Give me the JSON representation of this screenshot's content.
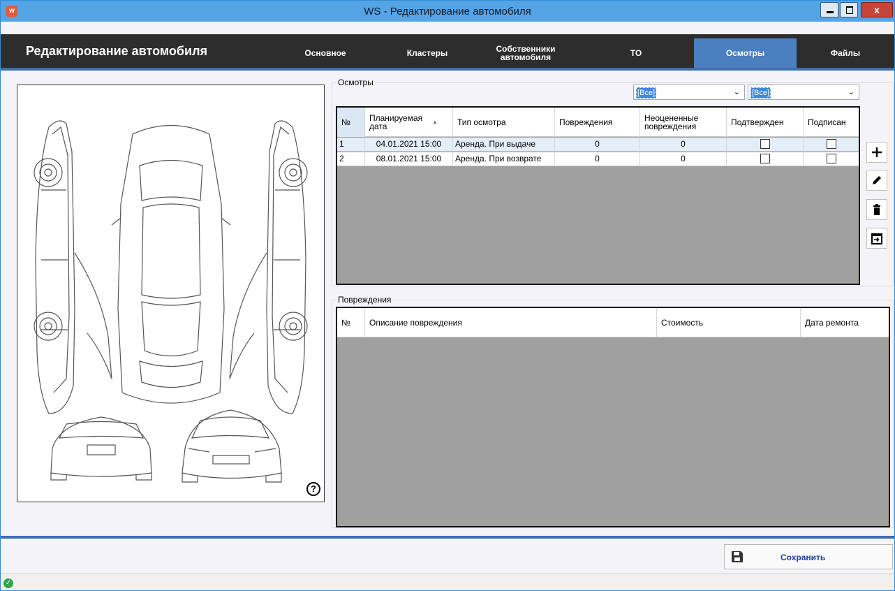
{
  "window": {
    "title": "WS - Редактирование автомобиля",
    "icon_letter": "w",
    "close_glyph": "x"
  },
  "header": {
    "title": "Редактирование автомобиля",
    "tabs": [
      {
        "label": "Основное"
      },
      {
        "label": "Кластеры"
      },
      {
        "label": "Собственники автомобиля"
      },
      {
        "label": "ТО"
      },
      {
        "label": "Осмотры",
        "active": true
      },
      {
        "label": "Файлы"
      }
    ]
  },
  "inspections": {
    "group_label": "Осмотры",
    "filter1": "[Все]",
    "filter2": "[Все]",
    "columns": [
      "№",
      "Планируемая дата",
      "Тип осмотра",
      "Повреждения",
      "Неоцененные повреждения",
      "Подтвержден",
      "Подписан"
    ],
    "rows": [
      {
        "no": "1",
        "date": "04.01.2021 15:00",
        "type": "Аренда. При выдаче",
        "damages": "0",
        "unassessed": "0",
        "confirmed": false,
        "signed": false
      },
      {
        "no": "2",
        "date": "08.01.2021 15:00",
        "type": "Аренда. При возврате",
        "damages": "0",
        "unassessed": "0",
        "confirmed": false,
        "signed": false
      }
    ]
  },
  "damages": {
    "group_label": "Повреждения",
    "columns": [
      "№",
      "Описание повреждения",
      "Стоимость",
      "Дата ремонта"
    ]
  },
  "actions": {
    "add": "plus-icon",
    "edit": "pencil-icon",
    "delete": "trash-icon",
    "schedule": "calendar-icon"
  },
  "car_panel": {
    "help": "?"
  },
  "footer": {
    "save_label": "Сохранить"
  },
  "status": {
    "ok_glyph": "✓"
  }
}
